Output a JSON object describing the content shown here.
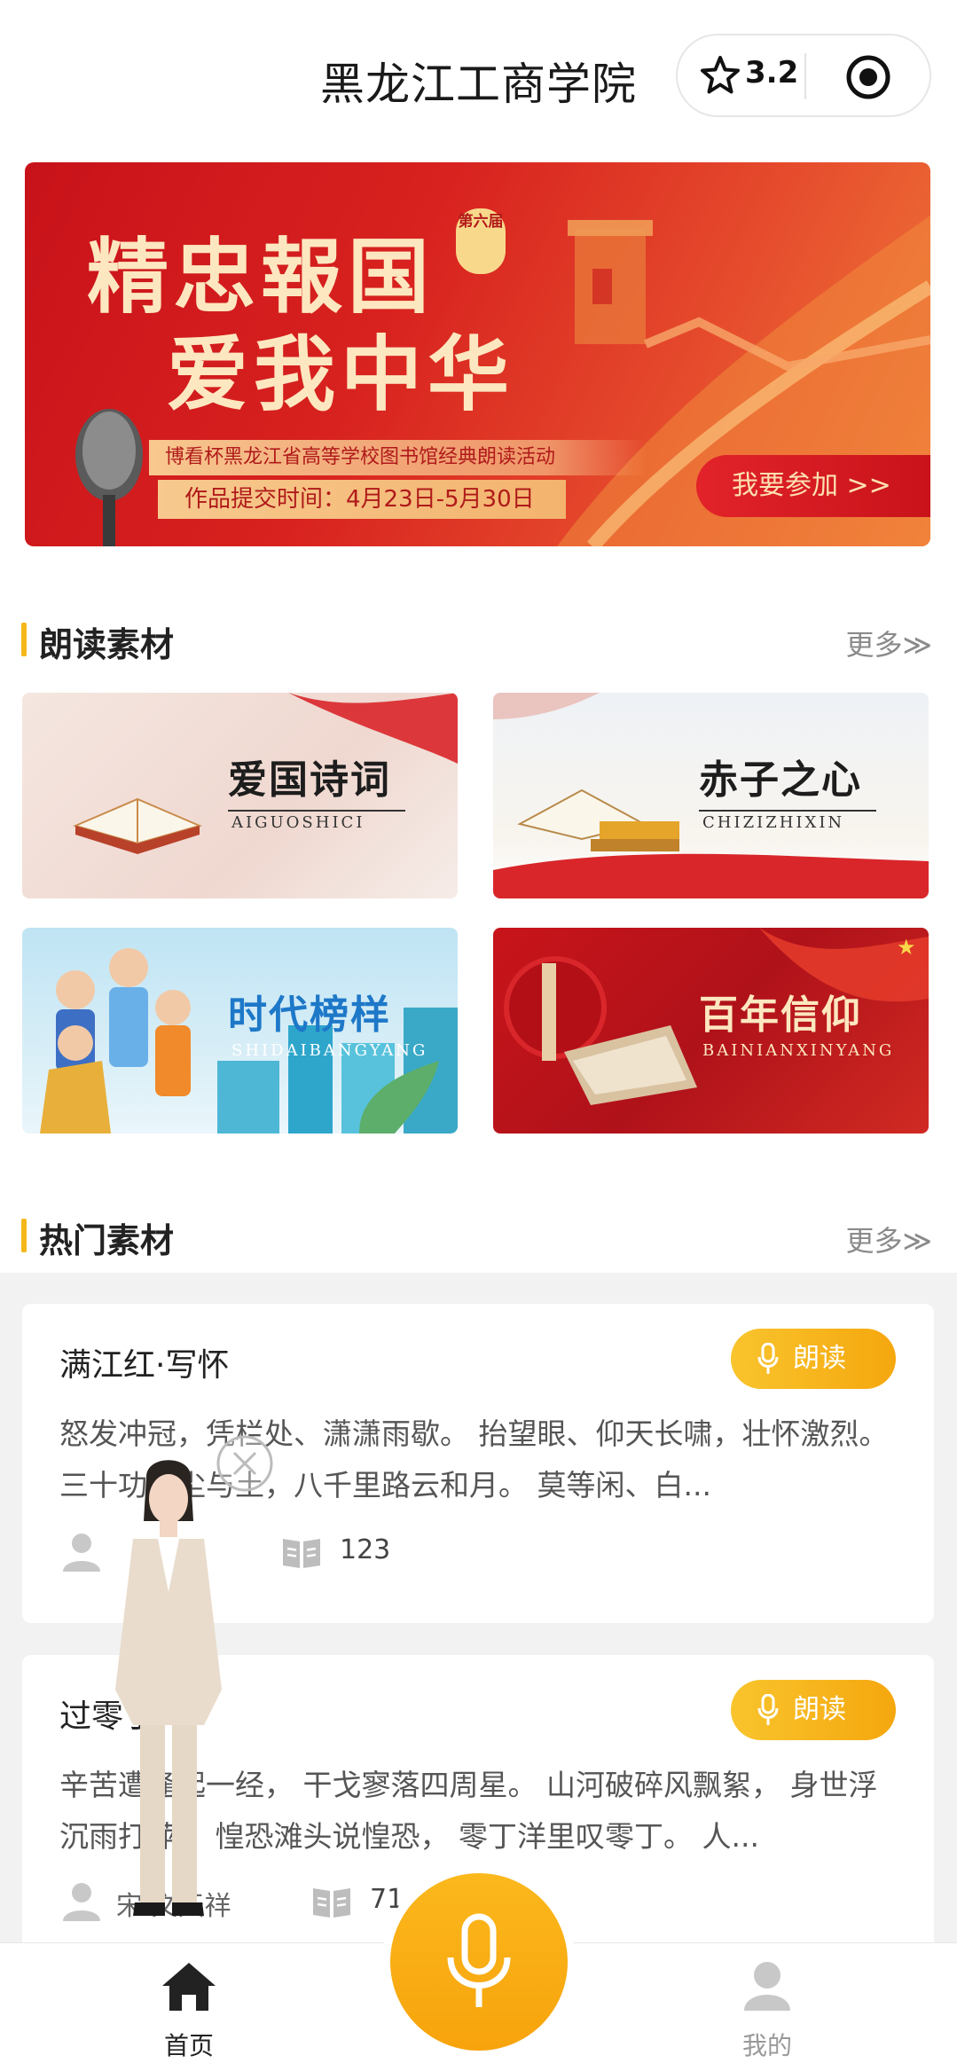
{
  "header": {
    "title": "黑龙江工商学院",
    "rating": "3.2",
    "icons": [
      "star-icon",
      "target-icon"
    ]
  },
  "banner": {
    "title_line1": "精忠報国",
    "title_line2": "爱我中华",
    "edition": "第六届",
    "activity": "博看杯黑龙江省高等学校图书馆经典朗读活动",
    "deadline": "作品提交时间：4月23日-5月30日",
    "join_button": "我要参加 >>"
  },
  "reading_section": {
    "title": "朗读素材",
    "more": "更多≫"
  },
  "materials": [
    {
      "title": "爱国诗词",
      "pinyin": "AIGUOSHICI"
    },
    {
      "title": "赤子之心",
      "pinyin": "CHIZIZHIXIN"
    },
    {
      "title": "时代榜样",
      "pinyin": "SHIDAIBANGYANG"
    },
    {
      "title": "百年信仰",
      "pinyin": "BAINIANXINYANG"
    }
  ],
  "hot_section": {
    "title": "热门素材",
    "more": "更多≫"
  },
  "poems": [
    {
      "title": "满江红·写怀",
      "read_label": "朗读",
      "body": "怒发冲冠，凭栏处、潇潇雨歇。 抬望眼、仰天长啸，壮怀激烈。三十功名尘与土，八千里路云和月。 莫等闲、白...",
      "author": "",
      "count": "123"
    },
    {
      "title": "过零丁洋",
      "read_label": "朗读",
      "body": "辛苦遭逢起一经， 干戈寥落四周星。 山河破碎风飘絮， 身世浮沉雨打萍。 惶恐滩头说惶恐， 零丁洋里叹零丁。 人...",
      "author": "宋 文天祥",
      "count": "71"
    }
  ],
  "tabbar": {
    "home": "首页",
    "mine": "我的"
  },
  "colors": {
    "accent": "#f4b81a",
    "banner_red": "#c8121a",
    "mic": "#f7a30c"
  }
}
